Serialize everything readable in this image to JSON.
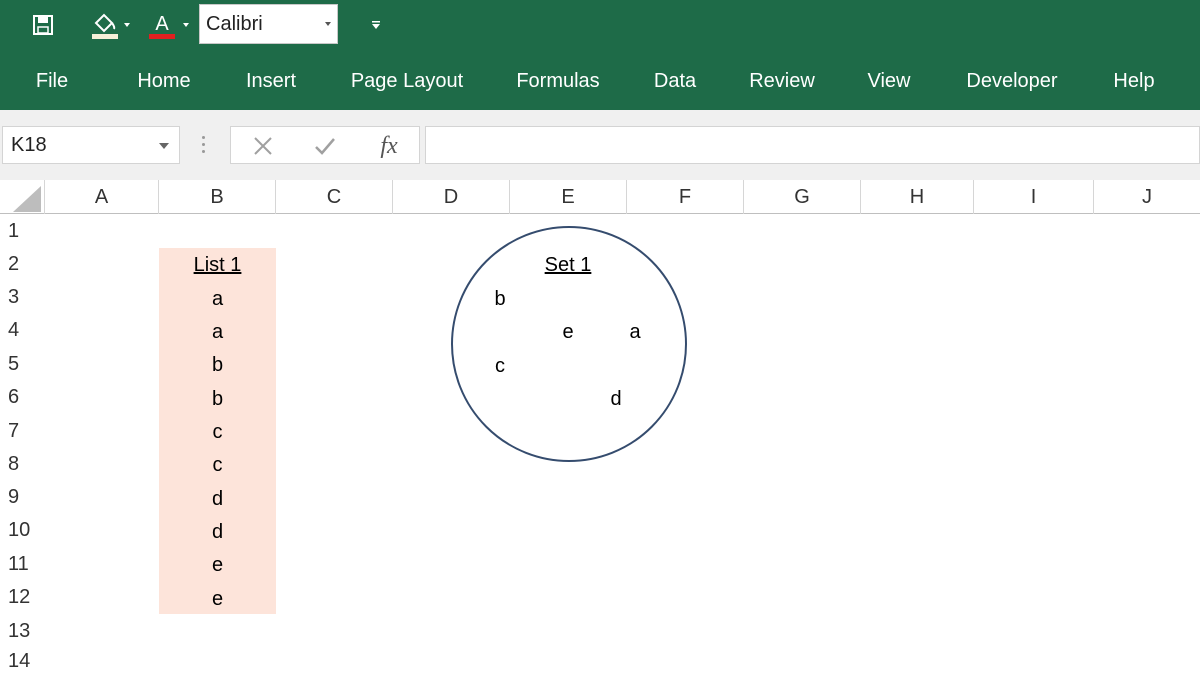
{
  "qat": {
    "font_name": "Calibri"
  },
  "tabs": [
    "File",
    "Home",
    "Insert",
    "Page Layout",
    "Formulas",
    "Data",
    "Review",
    "View",
    "Developer",
    "Help"
  ],
  "formula_bar": {
    "name_box": "K18",
    "fx_label": "fx",
    "formula_value": ""
  },
  "columns": [
    "A",
    "B",
    "C",
    "D",
    "E",
    "F",
    "G",
    "H",
    "I",
    "J"
  ],
  "rows": [
    "1",
    "2",
    "3",
    "4",
    "5",
    "6",
    "7",
    "8",
    "9",
    "10",
    "11",
    "12",
    "13",
    "14"
  ],
  "list": {
    "header": "List 1",
    "items": [
      "a",
      "a",
      "b",
      "b",
      "c",
      "c",
      "d",
      "d",
      "e",
      "e"
    ],
    "fill_color": "#fde4da"
  },
  "set": {
    "title": "Set 1",
    "elements": [
      "b",
      "e",
      "a",
      "c",
      "d"
    ],
    "outline_color": "#354c6e"
  },
  "colors": {
    "ribbon": "#1e6b48",
    "font_color_bar": "#e02020"
  }
}
